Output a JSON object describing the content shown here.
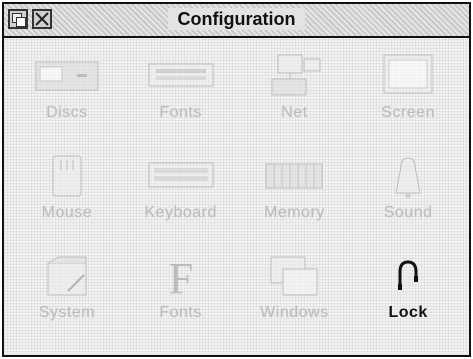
{
  "window": {
    "title": "Configuration"
  },
  "items": [
    {
      "label": "Discs",
      "icon": "discs-icon",
      "enabled": false
    },
    {
      "label": "Fonts",
      "icon": "fonts-icon",
      "enabled": false
    },
    {
      "label": "Net",
      "icon": "net-icon",
      "enabled": false
    },
    {
      "label": "Screen",
      "icon": "screen-icon",
      "enabled": false
    },
    {
      "label": "Mouse",
      "icon": "mouse-icon",
      "enabled": false
    },
    {
      "label": "Keyboard",
      "icon": "keyboard-icon",
      "enabled": false
    },
    {
      "label": "Memory",
      "icon": "memory-icon",
      "enabled": false
    },
    {
      "label": "Sound",
      "icon": "sound-icon",
      "enabled": false
    },
    {
      "label": "System",
      "icon": "system-icon",
      "enabled": false
    },
    {
      "label": "Fonts",
      "icon": "fonts-letter-icon",
      "enabled": false
    },
    {
      "label": "Windows",
      "icon": "windows-icon",
      "enabled": false
    },
    {
      "label": "Lock",
      "icon": "lock-icon",
      "enabled": true
    }
  ]
}
